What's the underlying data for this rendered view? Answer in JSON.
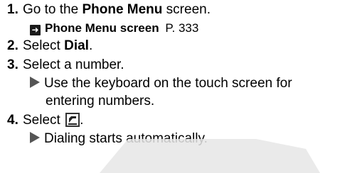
{
  "steps": [
    {
      "number": "1.",
      "text_before": "Go to the ",
      "bold": "Phone Menu",
      "text_after": " screen."
    },
    {
      "number": "2.",
      "text_before": "Select ",
      "bold": "Dial",
      "text_after": "."
    },
    {
      "number": "3.",
      "text_before": "Select a number."
    },
    {
      "number": "4.",
      "text_before": "Select ",
      "text_after": "."
    }
  ],
  "reference": {
    "label": "Phone Menu screen",
    "page": "P. 333",
    "icon": "arrow-right-icon"
  },
  "notes": {
    "keyboard_line1": "Use the keyboard on the touch screen for",
    "keyboard_line2": "entering numbers.",
    "dialing": "Dialing starts automatically."
  },
  "icons": {
    "bullet": "triangle-bullet-icon",
    "call": "phone-handset-icon"
  }
}
